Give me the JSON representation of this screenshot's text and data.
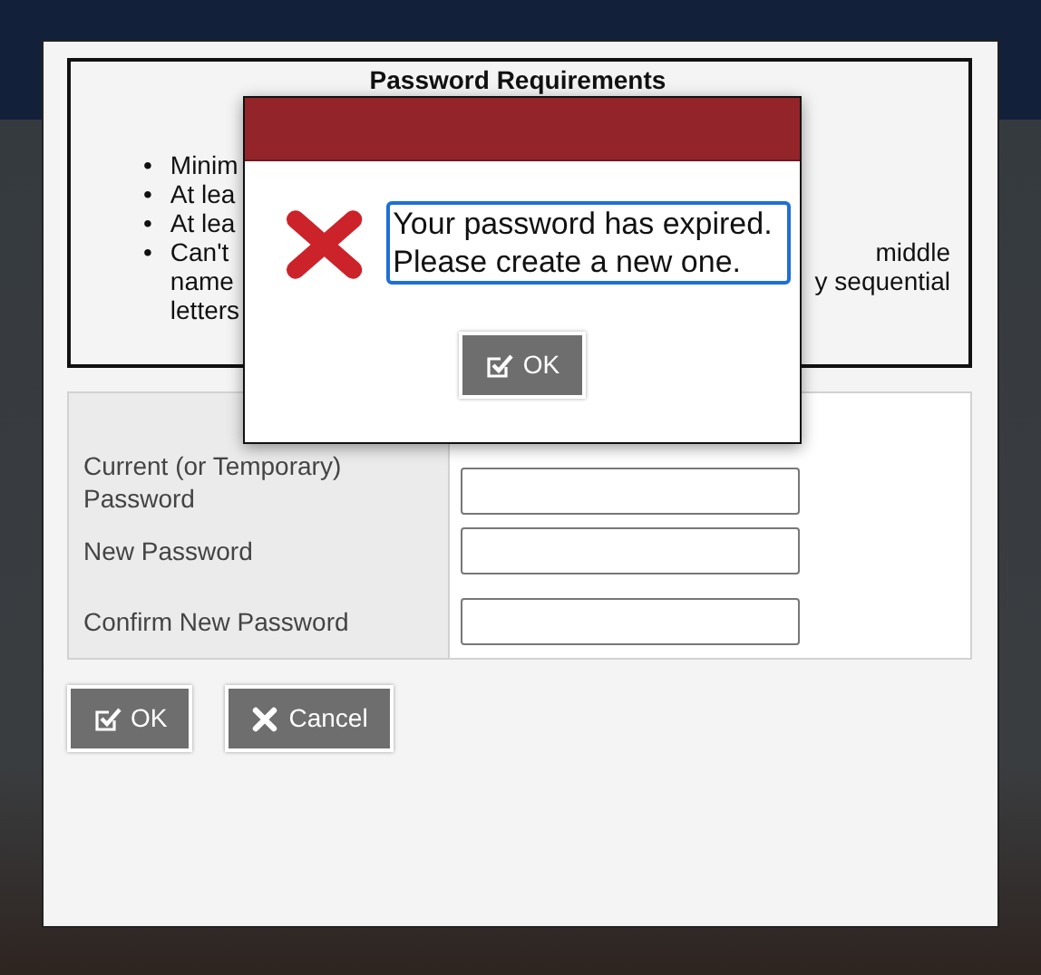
{
  "requirements": {
    "title": "Password Requirements",
    "items": [
      {
        "kind": "single",
        "marker": "•",
        "text": "Minim"
      },
      {
        "kind": "single",
        "marker": "•",
        "text": "At lea"
      },
      {
        "kind": "single",
        "marker": "•",
        "text": "At lea"
      },
      {
        "kind": "split",
        "marker": "•",
        "left_lines": [
          "Can't",
          "name",
          "letters"
        ],
        "right_lines": [
          "middle",
          "y sequential"
        ]
      }
    ]
  },
  "form": {
    "fields": [
      {
        "label": "Current (or Temporary) Password"
      },
      {
        "label": "New Password"
      },
      {
        "label": "Confirm New Password"
      }
    ]
  },
  "buttons": [
    {
      "kind": "ok",
      "label": "OK"
    },
    {
      "kind": "cancel",
      "label": "Cancel"
    }
  ],
  "alert": {
    "message": "Your password has expired. Please create a new one.",
    "button": {
      "kind": "ok",
      "label": "OK"
    }
  }
}
